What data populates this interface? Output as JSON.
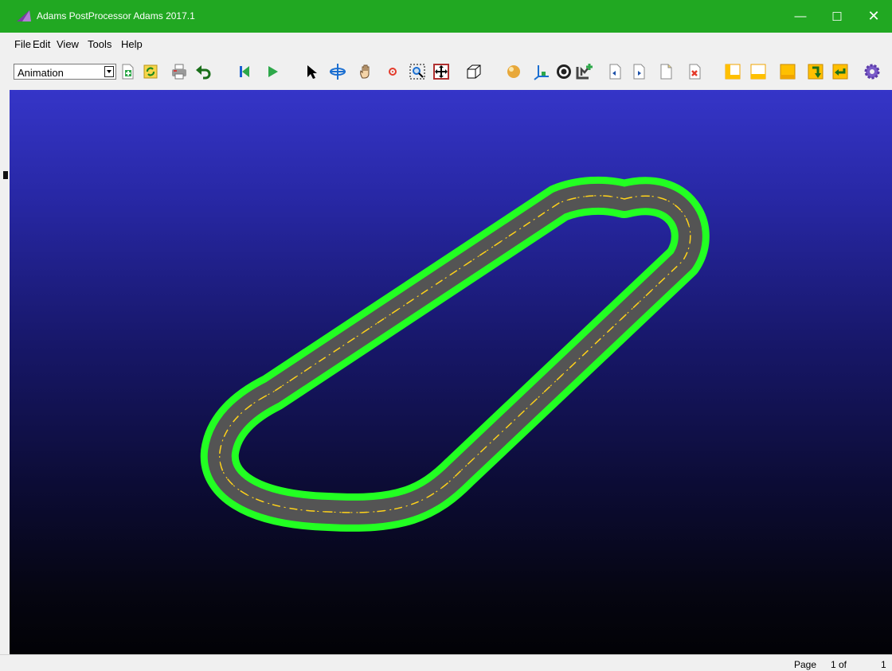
{
  "window": {
    "title": "Adams PostProcessor Adams 2017.1",
    "minimize": "—",
    "maximize": "☐",
    "close": "✕"
  },
  "menu": [
    "File",
    "Edit",
    "View",
    "Tools",
    "Help"
  ],
  "toolbar": {
    "mode_select": "Animation",
    "icons": [
      "new-page-icon",
      "refresh-icon",
      "print-icon",
      "undo-icon",
      "rewind-icon",
      "play-icon",
      "select-arrow-icon",
      "rotate-icon",
      "pan-hand-icon",
      "center-icon",
      "zoom-box-icon",
      "fit-icon",
      "wireframe-icon",
      "render-sphere-icon",
      "axes-triad-icon",
      "cycle-icon",
      "add-plot-icon",
      "prev-page-icon",
      "next-page-icon",
      "new-page-blank-icon",
      "delete-page-icon",
      "layout-left-icon",
      "layout-bottom-icon",
      "layout-full-icon",
      "export-icon",
      "return-icon",
      "settings-icon"
    ]
  },
  "colors": {
    "titlebar": "#21a822",
    "track_border": "#22ff22",
    "road": "#545454",
    "lane_marking": "#ffd21a",
    "viewport_top": "#3535c8",
    "viewport_bottom": "#020206"
  },
  "status": {
    "page_label": "Page",
    "page_current": "1 of",
    "page_total": "1"
  }
}
